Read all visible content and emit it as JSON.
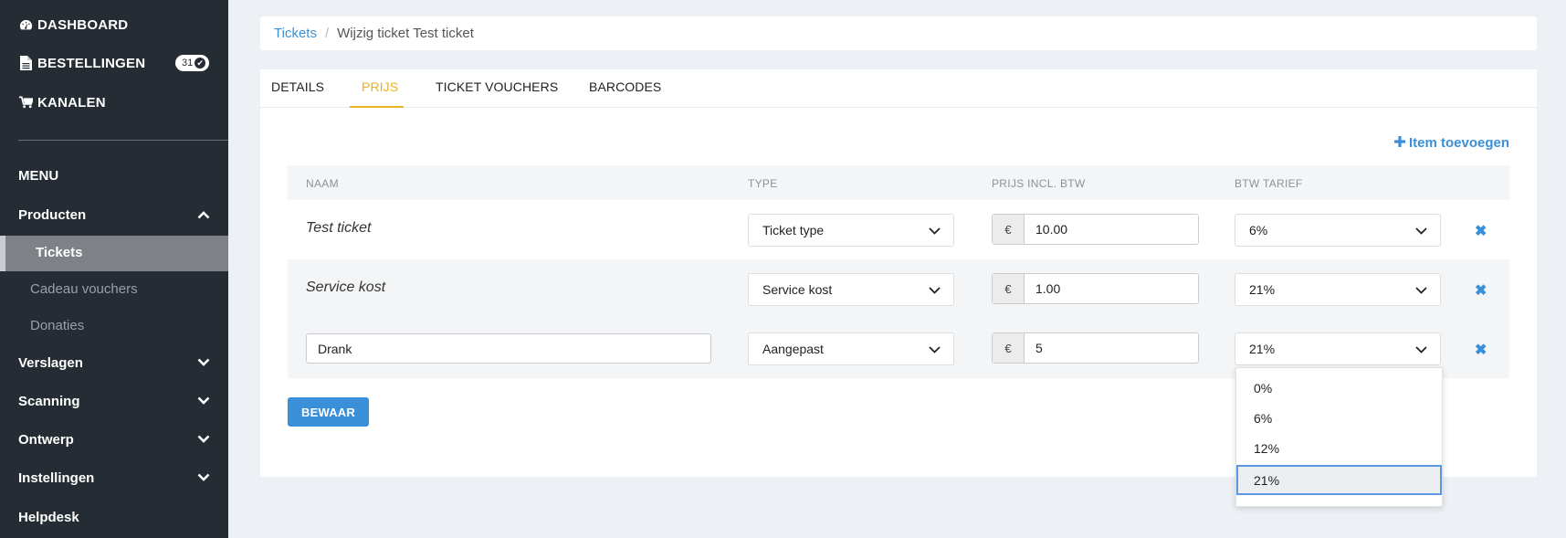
{
  "sidebar": {
    "top_items": [
      {
        "label": "DASHBOARD",
        "icon": "dashboard-icon"
      },
      {
        "label": "BESTELLINGEN",
        "icon": "document-icon",
        "badge": "31"
      },
      {
        "label": "KANALEN",
        "icon": "cart-icon"
      }
    ],
    "menu_header": "MENU",
    "nav": {
      "producten": "Producten",
      "tickets": "Tickets",
      "cadeau": "Cadeau vouchers",
      "donaties": "Donaties",
      "verslagen": "Verslagen",
      "scanning": "Scanning",
      "ontwerp": "Ontwerp",
      "instellingen": "Instellingen",
      "helpdesk": "Helpdesk"
    }
  },
  "breadcrumb": {
    "link": "Tickets",
    "separator": "/",
    "current": "Wijzig ticket Test ticket"
  },
  "tabs": [
    "DETAILS",
    "PRIJS",
    "TICKET VOUCHERS",
    "BARCODES"
  ],
  "active_tab": "PRIJS",
  "add_item_label": "Item toevoegen",
  "table": {
    "headers": {
      "naam": "NAAM",
      "type": "TYPE",
      "prijs": "PRIJS INCL. BTW",
      "btw": "BTW TARIEF"
    },
    "rows": [
      {
        "name": "Test ticket",
        "type": "Ticket type",
        "currency": "€",
        "price": "10.00",
        "vat": "6%"
      },
      {
        "name": "Service kost",
        "type": "Service kost",
        "currency": "€",
        "price": "1.00",
        "vat": "21%"
      },
      {
        "name": "Drank",
        "type": "Aangepast",
        "currency": "€",
        "price": "5",
        "vat": "21%"
      }
    ]
  },
  "save_label": "BEWAAR",
  "vat_dropdown": {
    "options": [
      "0%",
      "6%",
      "12%",
      "21%"
    ],
    "selected": "21%"
  },
  "colors": {
    "sidebar": "#252c33",
    "accent_blue": "#3a8fd9",
    "active_tab": "#e7b31e"
  }
}
